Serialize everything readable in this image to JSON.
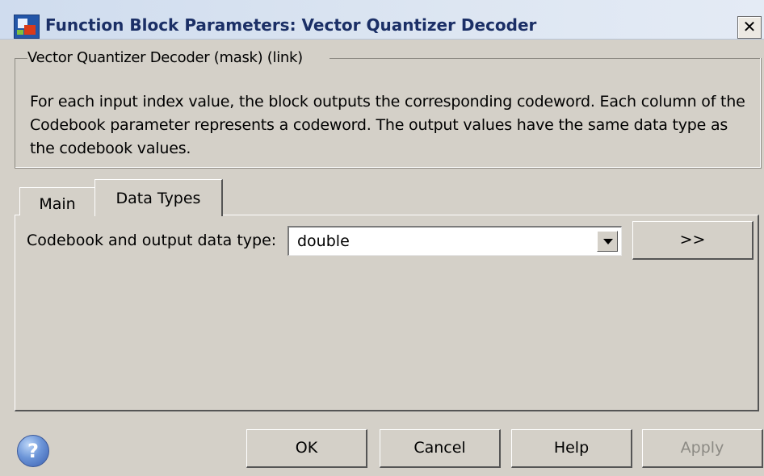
{
  "window": {
    "title": "Function Block Parameters: Vector Quantizer Decoder",
    "close_glyph": "✕"
  },
  "group": {
    "legend": "Vector Quantizer Decoder (mask) (link)",
    "description": "For each input index value, the block outputs the corresponding codeword. Each column of the Codebook parameter represents a codeword. The output values have the same data type as the codebook values."
  },
  "tabs": [
    {
      "label": "Main",
      "selected": false
    },
    {
      "label": "Data Types",
      "selected": true
    }
  ],
  "data_types": {
    "codebook_label": "Codebook and output data type:",
    "codebook_value": "double",
    "assistant_button": ">>"
  },
  "buttons": {
    "help_icon_glyph": "?",
    "ok": "OK",
    "cancel": "Cancel",
    "help": "Help",
    "apply": "Apply",
    "apply_enabled": false
  },
  "icons": {
    "app": "simulink-block-icon",
    "close": "close-icon",
    "help": "help-icon",
    "dropdown": "chevron-down-icon"
  }
}
